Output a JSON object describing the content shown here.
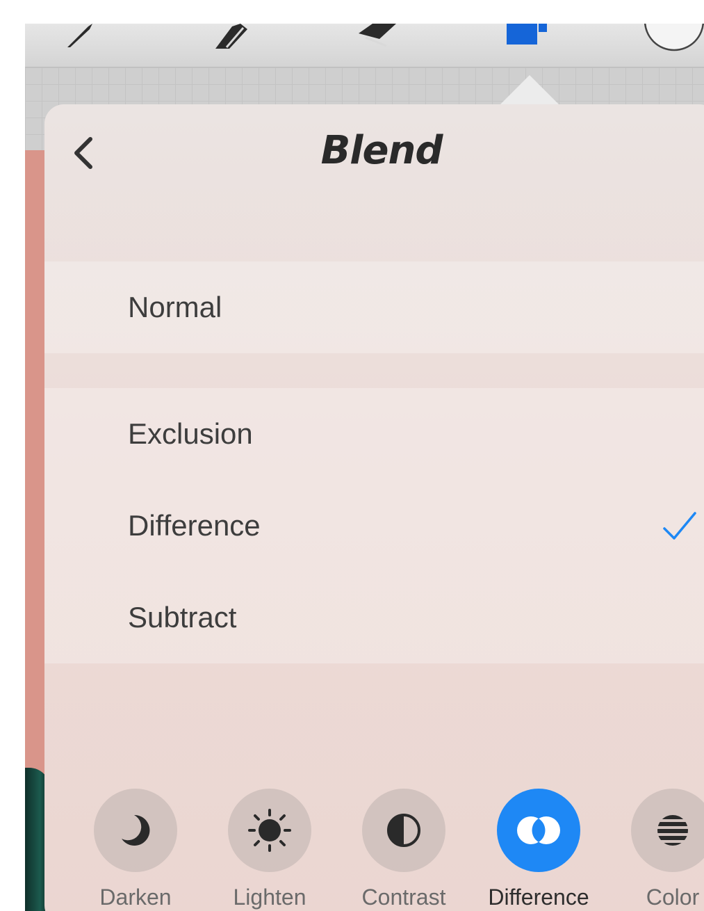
{
  "popover": {
    "title": "Blend",
    "back_icon": "chevron-left-icon"
  },
  "modes": {
    "primary": [
      {
        "label": "Normal"
      }
    ],
    "group": [
      {
        "label": "Exclusion",
        "selected": false
      },
      {
        "label": "Difference",
        "selected": true
      },
      {
        "label": "Subtract",
        "selected": false
      }
    ]
  },
  "mode_bar": [
    {
      "label": "Darken",
      "icon": "moon-icon",
      "active": false
    },
    {
      "label": "Lighten",
      "icon": "sun-icon",
      "active": false
    },
    {
      "label": "Contrast",
      "icon": "half-circle-icon",
      "active": false
    },
    {
      "label": "Difference",
      "icon": "overlap-circles-icon",
      "active": true
    },
    {
      "label": "Color",
      "icon": "striped-circle-icon",
      "active": false
    }
  ],
  "colors": {
    "accent": "#1e88f5",
    "layers_icon": "#1565d8"
  }
}
